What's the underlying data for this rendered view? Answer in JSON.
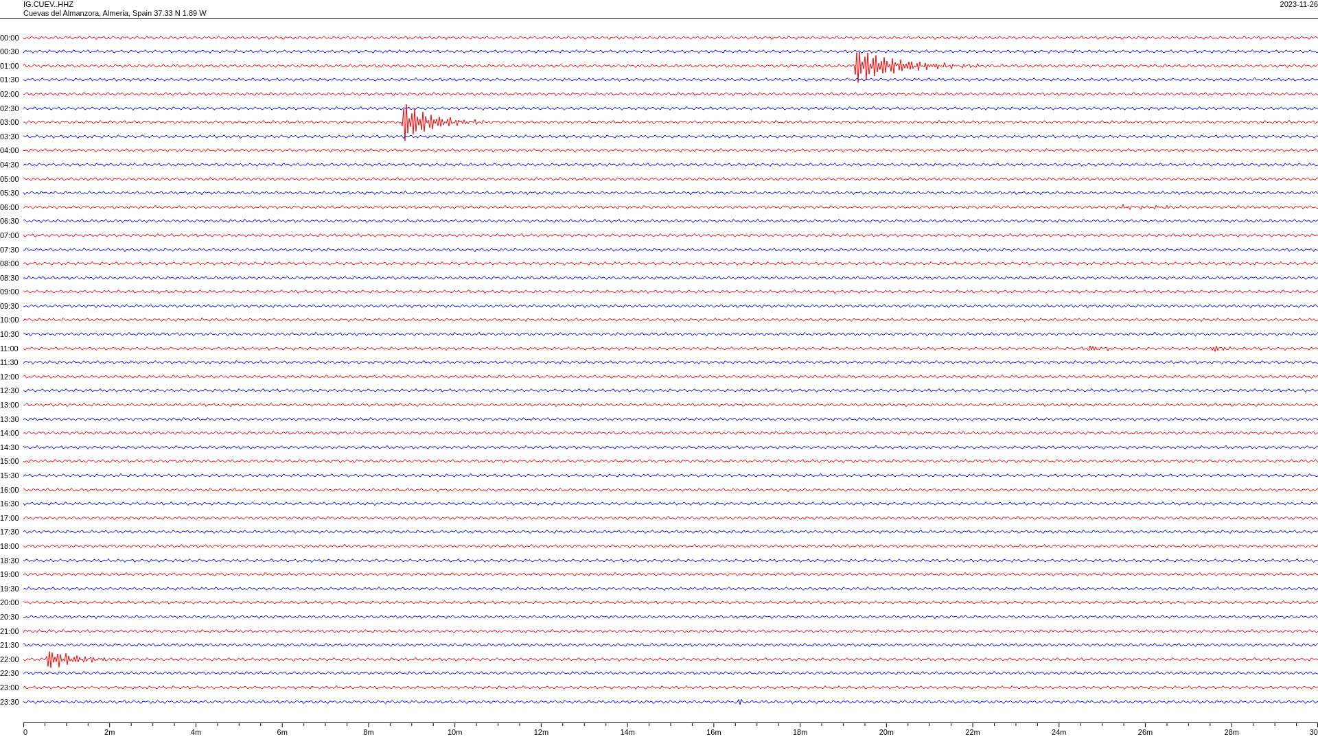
{
  "header": {
    "station": "IG.CUEV..HHZ",
    "location": "Cuevas del Almanzora, Almeria, Spain  37.33 N 1.89 W",
    "date": "2023-11-26"
  },
  "rows": [
    {
      "label": "00:00",
      "color": "#ff0000"
    },
    {
      "label": "00:30",
      "color": "#0000ff"
    },
    {
      "label": "01:00",
      "color": "#ff0000"
    },
    {
      "label": "01:30",
      "color": "#0000ff"
    },
    {
      "label": "02:00",
      "color": "#ff0000"
    },
    {
      "label": "02:30",
      "color": "#0000ff"
    },
    {
      "label": "03:00",
      "color": "#ff0000"
    },
    {
      "label": "03:30",
      "color": "#0000ff"
    },
    {
      "label": "04:00",
      "color": "#ff0000"
    },
    {
      "label": "04:30",
      "color": "#0000ff"
    },
    {
      "label": "05:00",
      "color": "#ff0000"
    },
    {
      "label": "05:30",
      "color": "#0000ff"
    },
    {
      "label": "06:00",
      "color": "#ff0000"
    },
    {
      "label": "06:30",
      "color": "#0000ff"
    },
    {
      "label": "07:00",
      "color": "#ff0000"
    },
    {
      "label": "07:30",
      "color": "#0000ff"
    },
    {
      "label": "08:00",
      "color": "#ff0000"
    },
    {
      "label": "08:30",
      "color": "#0000ff"
    },
    {
      "label": "09:00",
      "color": "#ff0000"
    },
    {
      "label": "09:30",
      "color": "#0000ff"
    },
    {
      "label": "10:00",
      "color": "#ff0000"
    },
    {
      "label": "10:30",
      "color": "#0000ff"
    },
    {
      "label": "11:00",
      "color": "#ff0000"
    },
    {
      "label": "11:30",
      "color": "#0000ff"
    },
    {
      "label": "12:00",
      "color": "#ff0000"
    },
    {
      "label": "12:30",
      "color": "#0000ff"
    },
    {
      "label": "13:00",
      "color": "#ff0000"
    },
    {
      "label": "13:30",
      "color": "#0000ff"
    },
    {
      "label": "14:00",
      "color": "#ff0000"
    },
    {
      "label": "14:30",
      "color": "#0000ff"
    },
    {
      "label": "15:00",
      "color": "#ff0000"
    },
    {
      "label": "15:30",
      "color": "#0000ff"
    },
    {
      "label": "16:00",
      "color": "#ff0000"
    },
    {
      "label": "16:30",
      "color": "#0000ff"
    },
    {
      "label": "17:00",
      "color": "#ff0000"
    },
    {
      "label": "17:30",
      "color": "#0000ff"
    },
    {
      "label": "18:00",
      "color": "#ff0000"
    },
    {
      "label": "18:30",
      "color": "#0000ff"
    },
    {
      "label": "19:00",
      "color": "#ff0000"
    },
    {
      "label": "19:30",
      "color": "#0000ff"
    },
    {
      "label": "20:00",
      "color": "#ff0000"
    },
    {
      "label": "20:30",
      "color": "#0000ff"
    },
    {
      "label": "21:00",
      "color": "#ff0000"
    },
    {
      "label": "21:30",
      "color": "#0000ff"
    },
    {
      "label": "22:00",
      "color": "#ff0000"
    },
    {
      "label": "22:30",
      "color": "#0000ff"
    },
    {
      "label": "23:00",
      "color": "#ff0000"
    },
    {
      "label": "23:30",
      "color": "#0000ff"
    }
  ],
  "x_axis": {
    "ticks": [
      "0",
      "2m",
      "4m",
      "6m",
      "8m",
      "10m",
      "12m",
      "14m",
      "16m",
      "18m",
      "20m",
      "22m",
      "24m",
      "26m",
      "28m",
      "30"
    ]
  }
}
